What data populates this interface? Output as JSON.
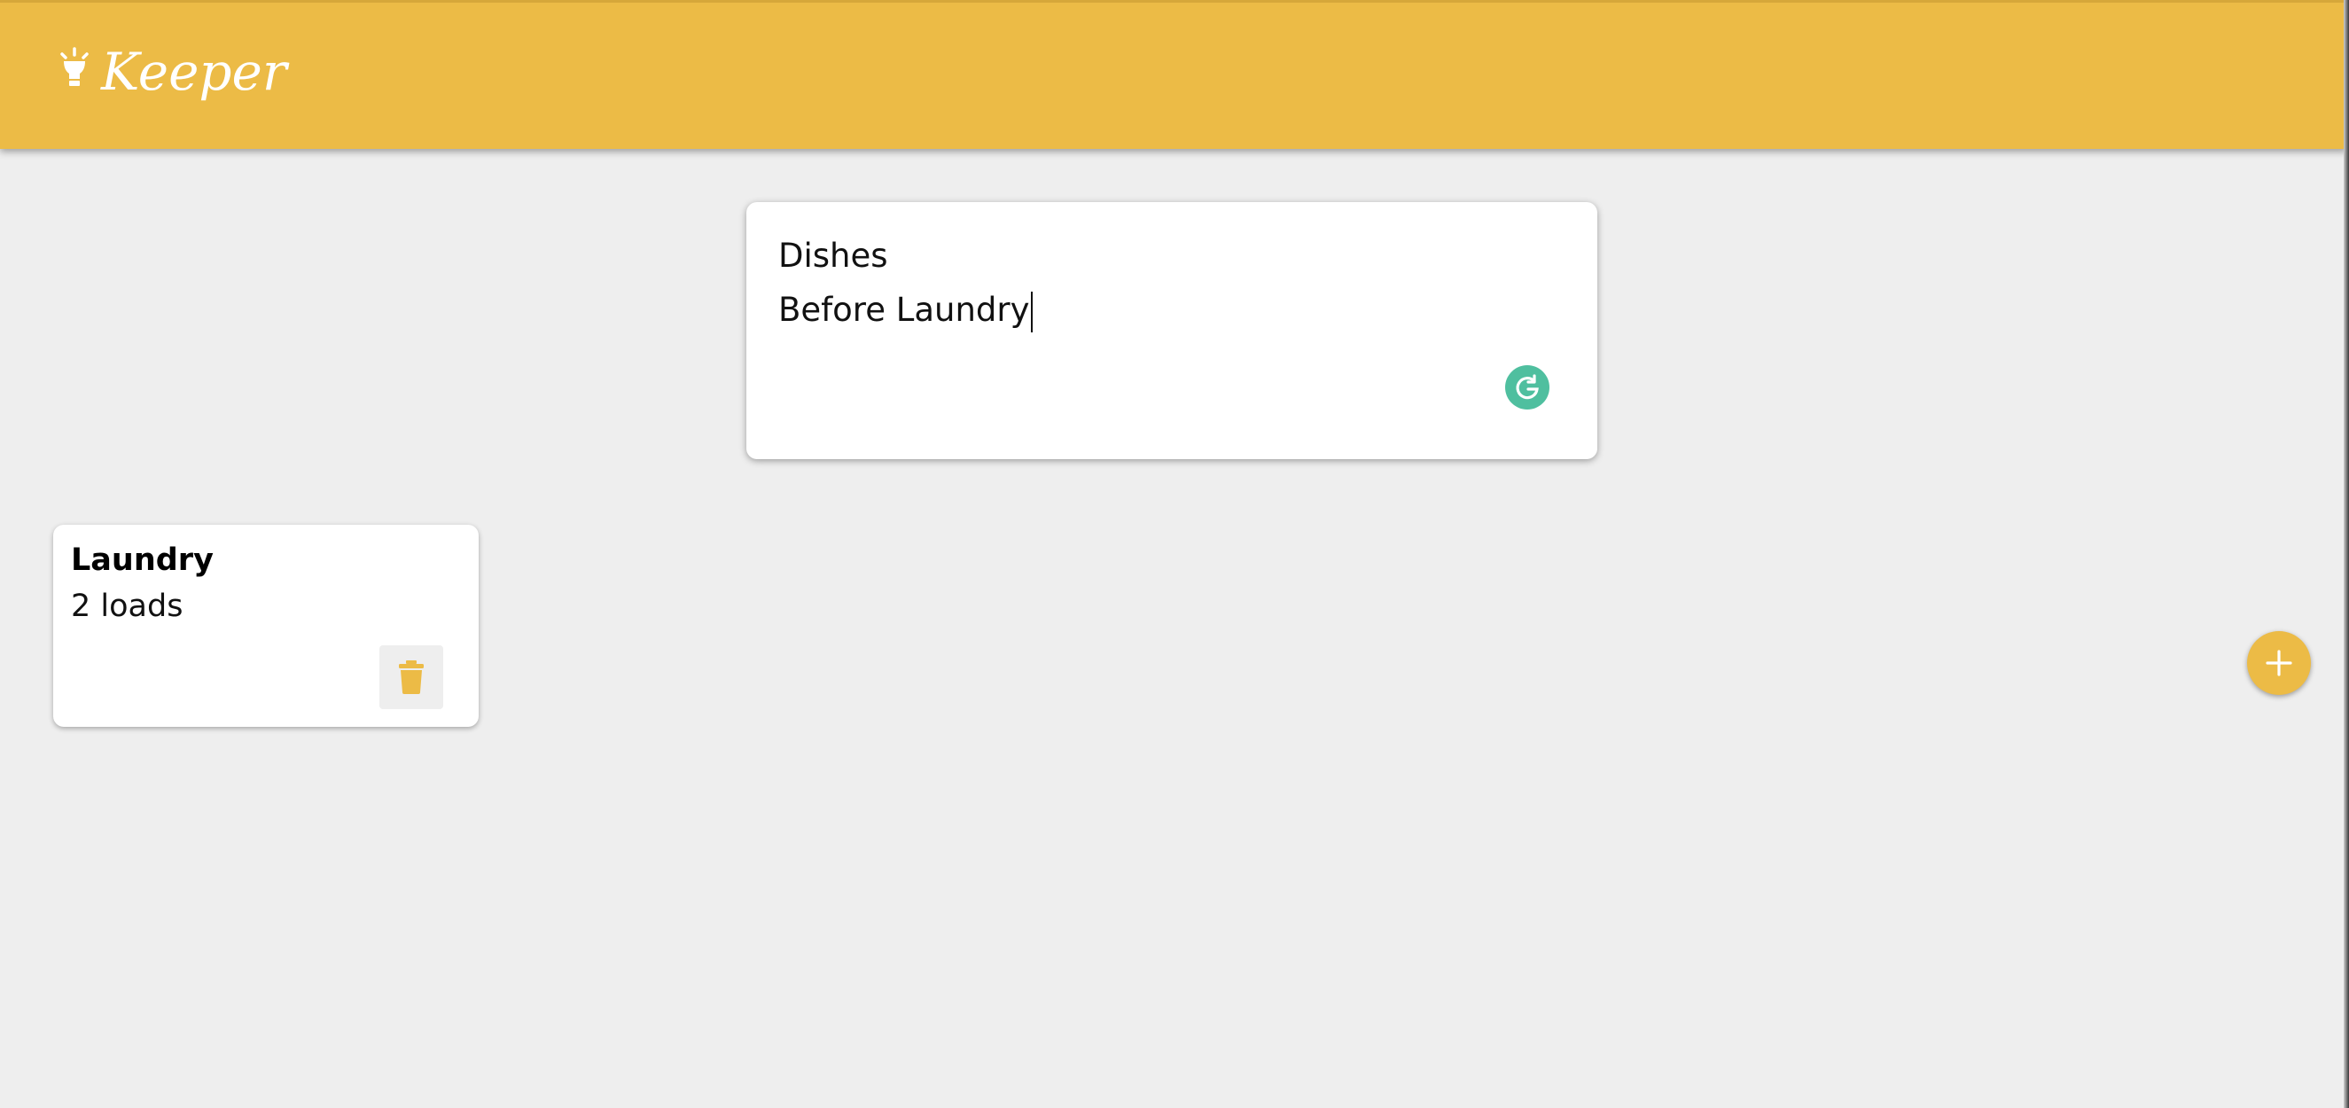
{
  "app": {
    "title": "Keeper",
    "accent_color": "#ecbb46",
    "logo_icon": "lightbulb-icon"
  },
  "create_note": {
    "title_value": "Dishes",
    "content_value": "Before Laundry",
    "grammarly_icon": "grammarly-icon",
    "add_icon": "plus-icon"
  },
  "notes": [
    {
      "title": "Laundry",
      "content": "2 loads",
      "delete_icon": "trash-icon"
    }
  ]
}
